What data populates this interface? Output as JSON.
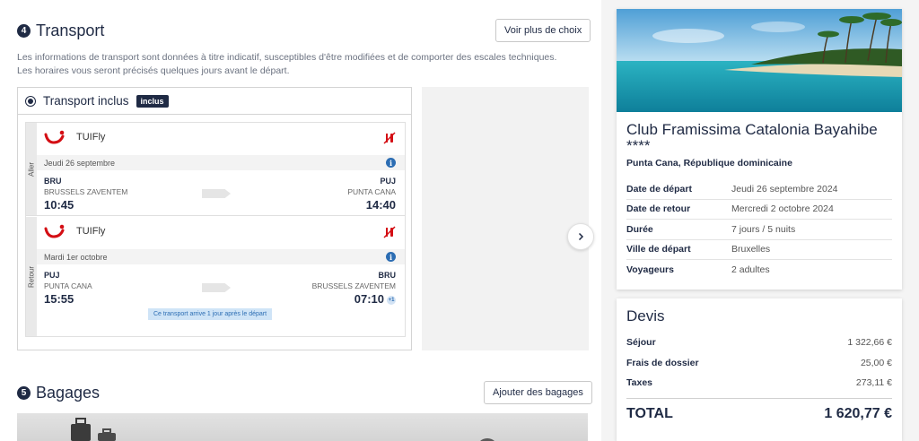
{
  "transport": {
    "step": "4",
    "title": "Transport",
    "more_choices_label": "Voir plus de choix",
    "info": "Les informations de transport sont données à titre indicatif, susceptibles d'être modifiées et de comporter des escales techniques. Les horaires vous seront précisés quelques jours avant le départ.",
    "option_label": "Transport inclus",
    "option_badge": "inclus",
    "outbound": {
      "side_label": "Aller",
      "carrier": "TUIFly",
      "date": "Jeudi 26 septembre",
      "from_code": "BRU",
      "from_city": "BRUSSELS ZAVENTEM",
      "from_time": "10:45",
      "to_code": "PUJ",
      "to_city": "PUNTA CANA",
      "to_time": "14:40"
    },
    "return": {
      "side_label": "Retour",
      "carrier": "TUIFly",
      "date": "Mardi 1er octobre",
      "from_code": "PUJ",
      "from_city": "PUNTA CANA",
      "from_time": "15:55",
      "to_code": "BRU",
      "to_city": "BRUSSELS ZAVENTEM",
      "to_time": "07:10",
      "day_offset": "+1",
      "notice": "Ce transport arrive 1 jour après le départ"
    }
  },
  "bagages": {
    "step": "5",
    "title": "Bagages",
    "add_label": "Ajouter des bagages"
  },
  "hotel": {
    "name": "Club Framissima Catalonia Bayahibe ****",
    "location": "Punta Cana, République dominicaine",
    "details": [
      {
        "label": "Date de départ",
        "value": "Jeudi 26 septembre 2024"
      },
      {
        "label": "Date de retour",
        "value": "Mercredi 2 octobre 2024"
      },
      {
        "label": "Durée",
        "value": "7 jours / 5 nuits"
      },
      {
        "label": "Ville de départ",
        "value": "Bruxelles"
      },
      {
        "label": "Voyageurs",
        "value": "2 adultes"
      }
    ]
  },
  "devis": {
    "title": "Devis",
    "rows": [
      {
        "label": "Séjour",
        "value": "1 322,66 €"
      },
      {
        "label": "Frais de dossier",
        "value": "25,00 €"
      },
      {
        "label": "Taxes",
        "value": "273,11 €"
      }
    ],
    "total_label": "TOTAL",
    "total_value": "1 620,77 €"
  },
  "colors": {
    "navy": "#1f2a44",
    "tui_red": "#d40e14",
    "info_blue": "#2c6db3"
  }
}
